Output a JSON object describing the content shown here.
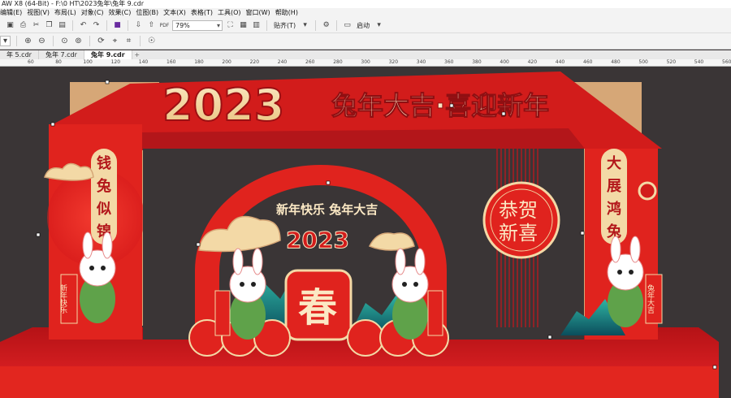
{
  "window": {
    "title": "AW X8 (64-Bit) - F:\\0 HT\\2023兔年\\兔年 9.cdr"
  },
  "menu": {
    "items": [
      "编辑(E)",
      "视图(V)",
      "布局(L)",
      "对象(C)",
      "效果(C)",
      "位图(B)",
      "文本(X)",
      "表格(T)",
      "工具(O)",
      "窗口(W)",
      "帮助(H)"
    ]
  },
  "toolbar": {
    "zoom_value": "79%",
    "snap_label": "贴齐(T)",
    "launch_label": "启动"
  },
  "tabs": [
    {
      "label": "年 5.cdr",
      "active": false
    },
    {
      "label": "兔年 7.cdr",
      "active": false
    },
    {
      "label": "兔年 9.cdr",
      "active": true
    }
  ],
  "ruler": {
    "labels": [
      "60",
      "80",
      "100",
      "120",
      "140",
      "160",
      "180",
      "200",
      "220",
      "240",
      "260",
      "280",
      "300",
      "320",
      "340",
      "360",
      "380",
      "400",
      "420",
      "440",
      "460",
      "480",
      "500",
      "520",
      "540",
      "560"
    ]
  },
  "design": {
    "main_number": "2023",
    "headline": "兔年大吉·喜迎新年",
    "left_banner": [
      "钱",
      "兔",
      "似",
      "锦"
    ],
    "right_banner": [
      "大",
      "展",
      "鸿",
      "兔"
    ],
    "arch_text": "新年快乐 兔年大吉",
    "center_number": "2023",
    "center_char": "春",
    "medallion_text": [
      "恭贺",
      "新喜"
    ],
    "scroll_left": "新年快乐",
    "scroll_right": "兔年大吉",
    "colors": {
      "red": "#e0231e",
      "dark_red": "#b3161a",
      "gold": "#f3d9a6",
      "bg": "#3a3536",
      "floor": "#c9151b"
    }
  }
}
